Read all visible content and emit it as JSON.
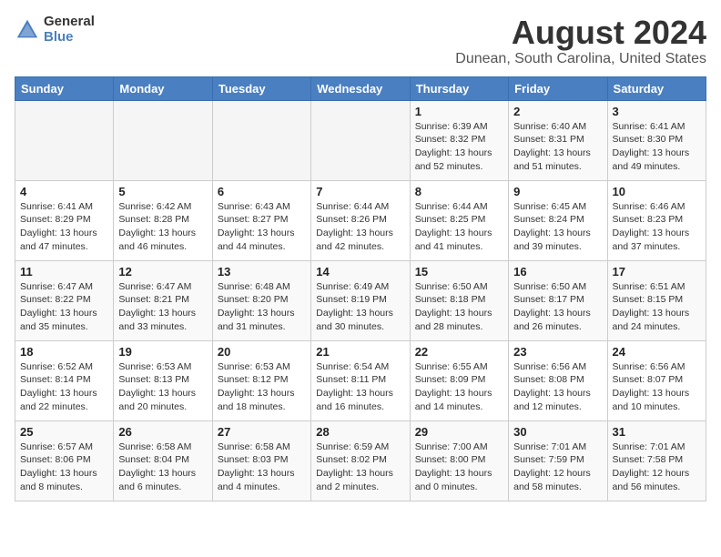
{
  "header": {
    "logo_general": "General",
    "logo_blue": "Blue",
    "title": "August 2024",
    "subtitle": "Dunean, South Carolina, United States"
  },
  "columns": [
    "Sunday",
    "Monday",
    "Tuesday",
    "Wednesday",
    "Thursday",
    "Friday",
    "Saturday"
  ],
  "weeks": [
    [
      {
        "day": "",
        "info": ""
      },
      {
        "day": "",
        "info": ""
      },
      {
        "day": "",
        "info": ""
      },
      {
        "day": "",
        "info": ""
      },
      {
        "day": "1",
        "info": "Sunrise: 6:39 AM\nSunset: 8:32 PM\nDaylight: 13 hours\nand 52 minutes."
      },
      {
        "day": "2",
        "info": "Sunrise: 6:40 AM\nSunset: 8:31 PM\nDaylight: 13 hours\nand 51 minutes."
      },
      {
        "day": "3",
        "info": "Sunrise: 6:41 AM\nSunset: 8:30 PM\nDaylight: 13 hours\nand 49 minutes."
      }
    ],
    [
      {
        "day": "4",
        "info": "Sunrise: 6:41 AM\nSunset: 8:29 PM\nDaylight: 13 hours\nand 47 minutes."
      },
      {
        "day": "5",
        "info": "Sunrise: 6:42 AM\nSunset: 8:28 PM\nDaylight: 13 hours\nand 46 minutes."
      },
      {
        "day": "6",
        "info": "Sunrise: 6:43 AM\nSunset: 8:27 PM\nDaylight: 13 hours\nand 44 minutes."
      },
      {
        "day": "7",
        "info": "Sunrise: 6:44 AM\nSunset: 8:26 PM\nDaylight: 13 hours\nand 42 minutes."
      },
      {
        "day": "8",
        "info": "Sunrise: 6:44 AM\nSunset: 8:25 PM\nDaylight: 13 hours\nand 41 minutes."
      },
      {
        "day": "9",
        "info": "Sunrise: 6:45 AM\nSunset: 8:24 PM\nDaylight: 13 hours\nand 39 minutes."
      },
      {
        "day": "10",
        "info": "Sunrise: 6:46 AM\nSunset: 8:23 PM\nDaylight: 13 hours\nand 37 minutes."
      }
    ],
    [
      {
        "day": "11",
        "info": "Sunrise: 6:47 AM\nSunset: 8:22 PM\nDaylight: 13 hours\nand 35 minutes."
      },
      {
        "day": "12",
        "info": "Sunrise: 6:47 AM\nSunset: 8:21 PM\nDaylight: 13 hours\nand 33 minutes."
      },
      {
        "day": "13",
        "info": "Sunrise: 6:48 AM\nSunset: 8:20 PM\nDaylight: 13 hours\nand 31 minutes."
      },
      {
        "day": "14",
        "info": "Sunrise: 6:49 AM\nSunset: 8:19 PM\nDaylight: 13 hours\nand 30 minutes."
      },
      {
        "day": "15",
        "info": "Sunrise: 6:50 AM\nSunset: 8:18 PM\nDaylight: 13 hours\nand 28 minutes."
      },
      {
        "day": "16",
        "info": "Sunrise: 6:50 AM\nSunset: 8:17 PM\nDaylight: 13 hours\nand 26 minutes."
      },
      {
        "day": "17",
        "info": "Sunrise: 6:51 AM\nSunset: 8:15 PM\nDaylight: 13 hours\nand 24 minutes."
      }
    ],
    [
      {
        "day": "18",
        "info": "Sunrise: 6:52 AM\nSunset: 8:14 PM\nDaylight: 13 hours\nand 22 minutes."
      },
      {
        "day": "19",
        "info": "Sunrise: 6:53 AM\nSunset: 8:13 PM\nDaylight: 13 hours\nand 20 minutes."
      },
      {
        "day": "20",
        "info": "Sunrise: 6:53 AM\nSunset: 8:12 PM\nDaylight: 13 hours\nand 18 minutes."
      },
      {
        "day": "21",
        "info": "Sunrise: 6:54 AM\nSunset: 8:11 PM\nDaylight: 13 hours\nand 16 minutes."
      },
      {
        "day": "22",
        "info": "Sunrise: 6:55 AM\nSunset: 8:09 PM\nDaylight: 13 hours\nand 14 minutes."
      },
      {
        "day": "23",
        "info": "Sunrise: 6:56 AM\nSunset: 8:08 PM\nDaylight: 13 hours\nand 12 minutes."
      },
      {
        "day": "24",
        "info": "Sunrise: 6:56 AM\nSunset: 8:07 PM\nDaylight: 13 hours\nand 10 minutes."
      }
    ],
    [
      {
        "day": "25",
        "info": "Sunrise: 6:57 AM\nSunset: 8:06 PM\nDaylight: 13 hours\nand 8 minutes."
      },
      {
        "day": "26",
        "info": "Sunrise: 6:58 AM\nSunset: 8:04 PM\nDaylight: 13 hours\nand 6 minutes."
      },
      {
        "day": "27",
        "info": "Sunrise: 6:58 AM\nSunset: 8:03 PM\nDaylight: 13 hours\nand 4 minutes."
      },
      {
        "day": "28",
        "info": "Sunrise: 6:59 AM\nSunset: 8:02 PM\nDaylight: 13 hours\nand 2 minutes."
      },
      {
        "day": "29",
        "info": "Sunrise: 7:00 AM\nSunset: 8:00 PM\nDaylight: 13 hours\nand 0 minutes."
      },
      {
        "day": "30",
        "info": "Sunrise: 7:01 AM\nSunset: 7:59 PM\nDaylight: 12 hours\nand 58 minutes."
      },
      {
        "day": "31",
        "info": "Sunrise: 7:01 AM\nSunset: 7:58 PM\nDaylight: 12 hours\nand 56 minutes."
      }
    ]
  ]
}
